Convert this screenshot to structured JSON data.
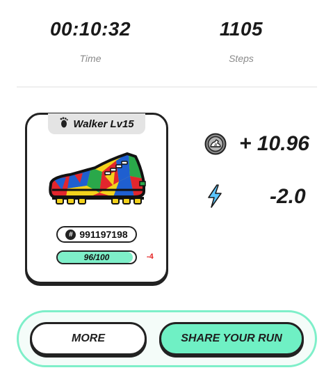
{
  "stats": {
    "time": {
      "value": "00:10:32",
      "label": "Time"
    },
    "steps": {
      "value": "1105",
      "label": "Steps"
    }
  },
  "sneaker": {
    "level_label": "Walker Lv15",
    "id": "991197198",
    "durability": {
      "text": "96/100",
      "value": 96,
      "max": 100,
      "delta": "-4"
    }
  },
  "rewards": {
    "coin": {
      "icon": "coin-icon",
      "value": "+ 10.96"
    },
    "energy": {
      "icon": "lightning-bolt-icon",
      "value": "-2.0"
    }
  },
  "buttons": {
    "more": "MORE",
    "share": "SHARE YOUR RUN"
  },
  "colors": {
    "accent": "#6ff0c4",
    "danger": "#e52222",
    "bolt": "#5cc6ff"
  }
}
